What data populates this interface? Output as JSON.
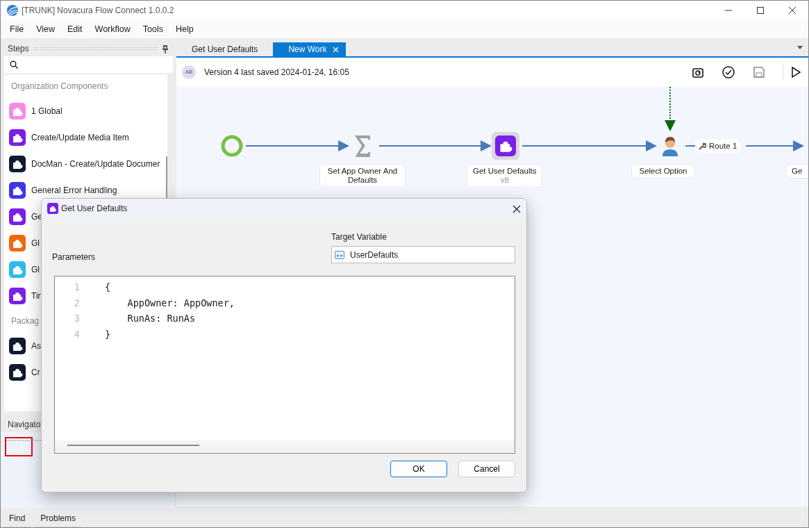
{
  "window": {
    "title": "[TRUNK] Novacura Flow Connect 1.0.0.2"
  },
  "menu": [
    "File",
    "View",
    "Edit",
    "Workflow",
    "Tools",
    "Help"
  ],
  "steps_panel": {
    "title": "Steps",
    "groups": [
      {
        "label": "Organization Components",
        "items": [
          {
            "label": "1 Global",
            "color": "#f78ae6"
          },
          {
            "label": "Create/Update Media Item",
            "color": "#7b1fe8"
          },
          {
            "label": "DocMan - Create/Update Documer",
            "color": "#121a33"
          },
          {
            "label": "General Error Handling",
            "color": "#3d35e6"
          },
          {
            "label": "Ge",
            "color": "#7b1fe8"
          },
          {
            "label": "Gl",
            "color": "#f2670f"
          },
          {
            "label": "Gl",
            "color": "#2ebbee"
          },
          {
            "label": "Tir",
            "color": "#7b1fe8"
          }
        ]
      },
      {
        "label": "Packag",
        "items": [
          {
            "label": "As",
            "color": "#121a33"
          },
          {
            "label": "Cr",
            "color": "#121a33"
          }
        ]
      }
    ]
  },
  "navigator": {
    "title": "Navigato"
  },
  "bottom_tabs": [
    "Find",
    "Problems"
  ],
  "editor_tabs": [
    {
      "label": "Get User Defaults",
      "selected": false
    },
    {
      "label": "New Work",
      "selected": true
    }
  ],
  "toolbar": {
    "avatar": "AB",
    "version_text": "Version 4 last saved 2024-01-24, 16:05"
  },
  "flow": {
    "nodes": [
      {
        "kind": "start"
      },
      {
        "kind": "sum",
        "label": "Set App Owner And Defaults"
      },
      {
        "kind": "component",
        "label": "Get User Defaults",
        "sublabel": "v8"
      },
      {
        "kind": "user",
        "label": "Select Option"
      },
      {
        "kind": "partial",
        "label": "Ge"
      }
    ],
    "route_label": "Route 1"
  },
  "dialog": {
    "title": "Get User Defaults",
    "parameters_label": "Parameters",
    "target_label": "Target Variable",
    "target_value": "UserDefaults",
    "code_lines": [
      {
        "number": "1",
        "code": "{"
      },
      {
        "number": "2",
        "code": "    AppOwner: AppOwner,"
      },
      {
        "number": "3",
        "code": "    RunAs: RunAs"
      },
      {
        "number": "4",
        "code": "}"
      }
    ],
    "buttons": [
      {
        "label": "OK",
        "default": true
      },
      {
        "label": "Cancel",
        "default": false
      }
    ]
  }
}
